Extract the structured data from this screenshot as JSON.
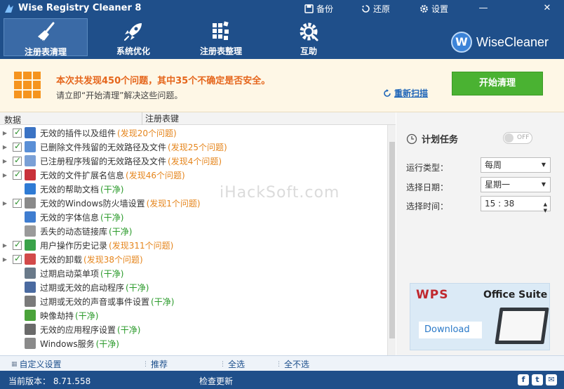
{
  "window": {
    "title": "Wise Registry Cleaner 8",
    "actions": [
      {
        "label": "备份",
        "icon": "backup-icon"
      },
      {
        "label": "还原",
        "icon": "restore-icon"
      },
      {
        "label": "设置",
        "icon": "gear-icon"
      }
    ],
    "controls": {
      "minimize": "—",
      "close": "✕"
    }
  },
  "tabs": [
    {
      "label": "注册表清理",
      "icon": "broom-icon",
      "active": true
    },
    {
      "label": "系统优化",
      "icon": "rocket-icon",
      "active": false
    },
    {
      "label": "注册表整理",
      "icon": "defrag-icon",
      "active": false
    },
    {
      "label": "互助",
      "icon": "help-gear-icon",
      "active": false
    }
  ],
  "brand": {
    "logo_letter": "W",
    "name": "WiseCleaner"
  },
  "alert": {
    "main": "本次共发现450个问题，其中35个不确定是否安全。",
    "sub": "请立即“开始清理”解决这些问题。",
    "rescan": "重新扫描",
    "start": "开始清理"
  },
  "list": {
    "columns": {
      "data": "数据",
      "key": "注册表键"
    },
    "items": [
      {
        "label": "无效的插件以及组件",
        "status": "(发现20个问题)",
        "type": "issue",
        "expandable": true,
        "checkbox": true,
        "icon_color": "#3b73c4"
      },
      {
        "label": "已删除文件残留的无效路径及文件",
        "status": "(发现25个问题)",
        "type": "issue",
        "expandable": true,
        "checkbox": true,
        "icon_color": "#5a8fd6"
      },
      {
        "label": "已注册程序残留的无效路径及文件",
        "status": "(发现4个问题)",
        "type": "issue",
        "expandable": true,
        "checkbox": true,
        "icon_color": "#7aa0d6"
      },
      {
        "label": "无效的文件扩展名信息",
        "status": "(发现46个问题)",
        "type": "issue",
        "expandable": true,
        "checkbox": true,
        "icon_color": "#c9313a"
      },
      {
        "label": "无效的帮助文档",
        "status": "(干净)",
        "type": "clean",
        "expandable": false,
        "checkbox": false,
        "icon_color": "#2f7bd4"
      },
      {
        "label": "无效的Windows防火墙设置",
        "status": "(发现1个问题)",
        "type": "issue",
        "expandable": true,
        "checkbox": true,
        "icon_color": "#8a8a8a"
      },
      {
        "label": "无效的字体信息",
        "status": "(干净)",
        "type": "clean",
        "expandable": false,
        "checkbox": false,
        "icon_color": "#3f7dd0"
      },
      {
        "label": "丢失的动态链接库",
        "status": "(干净)",
        "type": "clean",
        "expandable": false,
        "checkbox": false,
        "icon_color": "#9a9a9a"
      },
      {
        "label": "用户操作历史记录",
        "status": "(发现311个问题)",
        "type": "issue",
        "expandable": true,
        "checkbox": true,
        "icon_color": "#3aa34a"
      },
      {
        "label": "无效的卸载",
        "status": "(发现38个问题)",
        "type": "issue",
        "expandable": true,
        "checkbox": true,
        "icon_color": "#d24a4a"
      },
      {
        "label": "过期启动菜单项",
        "status": "(干净)",
        "type": "clean",
        "expandable": false,
        "checkbox": false,
        "icon_color": "#6a7a8a"
      },
      {
        "label": "过期或无效的启动程序",
        "status": "(干净)",
        "type": "clean",
        "expandable": false,
        "checkbox": false,
        "icon_color": "#4a6aa0"
      },
      {
        "label": "过期或无效的声音或事件设置",
        "status": "(干净)",
        "type": "clean",
        "expandable": false,
        "checkbox": false,
        "icon_color": "#7a7a7a"
      },
      {
        "label": "映像劫持",
        "status": "(干净)",
        "type": "clean",
        "expandable": false,
        "checkbox": false,
        "icon_color": "#4aa33a"
      },
      {
        "label": "无效的应用程序设置",
        "status": "(干净)",
        "type": "clean",
        "expandable": false,
        "checkbox": false,
        "icon_color": "#6a6a6a"
      },
      {
        "label": "Windows服务",
        "status": "(干净)",
        "type": "clean",
        "expandable": false,
        "checkbox": false,
        "icon_color": "#8a8a8a"
      }
    ]
  },
  "schedule": {
    "title": "计划任务",
    "toggle": "OFF",
    "fields": [
      {
        "label": "运行类型：",
        "value": "每周",
        "kind": "select"
      },
      {
        "label": "选择日期：",
        "value": "星期一",
        "kind": "select"
      },
      {
        "label": "选择时间：",
        "value": "15 : 38",
        "kind": "spin"
      }
    ]
  },
  "ad": {
    "logo": "WPS",
    "product": "Office Suite",
    "button": "Download"
  },
  "actionbar": {
    "custom": "自定义设置",
    "recommend": "推荐",
    "select_all": "全选",
    "select_none": "全不选"
  },
  "statusbar": {
    "version": "当前版本： 8.71.558",
    "update": "检查更新",
    "social": [
      "f",
      "t",
      "✉"
    ]
  },
  "watermark": "iHackSoft.com",
  "colors": {
    "header": "#1f4f8a",
    "accent_orange": "#e5661c",
    "start_green": "#4ab232",
    "clean_green": "#2a9a2a"
  }
}
